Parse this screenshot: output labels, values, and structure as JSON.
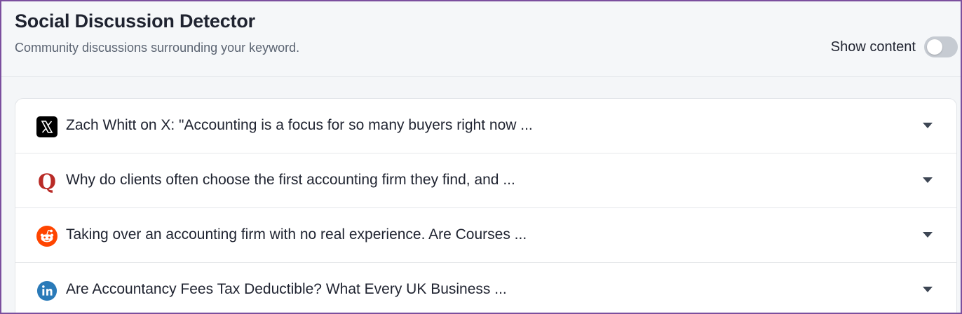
{
  "header": {
    "title": "Social Discussion Detector",
    "subtitle": "Community discussions surrounding your keyword.",
    "toggle_label": "Show content",
    "toggle_on": false
  },
  "items": [
    {
      "icon": "x-twitter-icon",
      "text": "Zach Whitt on X: \"Accounting is a focus for so many buyers right now ..."
    },
    {
      "icon": "quora-icon",
      "text": "Why do clients often choose the first accounting firm they find, and ..."
    },
    {
      "icon": "reddit-icon",
      "text": "Taking over an accounting firm with no real experience. Are Courses ..."
    },
    {
      "icon": "linkedin-icon",
      "text": "Are Accountancy Fees Tax Deductible? What Every UK Business ..."
    }
  ],
  "colors": {
    "border_accent": "#7b4f9e",
    "quora": "#b92b27",
    "reddit": "#ff4500",
    "linkedin": "#2a7ab8"
  }
}
